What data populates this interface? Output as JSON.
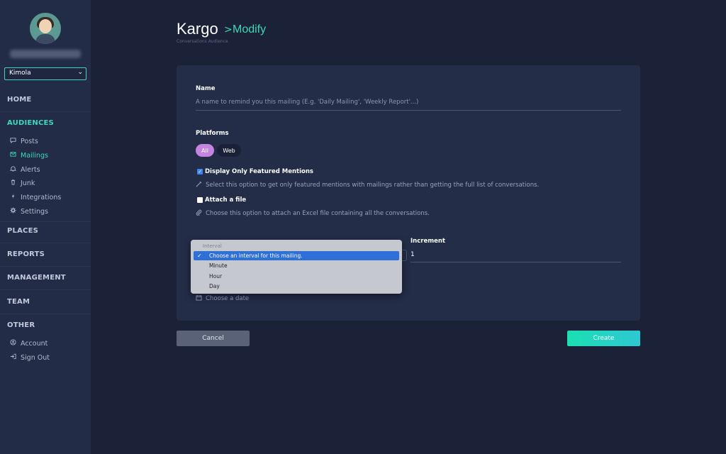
{
  "sidebar": {
    "account": "Kimola",
    "nav": {
      "home": "HOME",
      "audiences": "AUDIENCES",
      "places": "PLACES",
      "reports": "REPORTS",
      "management": "MANAGEMENT",
      "team": "TEAM",
      "other": "OTHER"
    },
    "audience_items": [
      {
        "label": "Posts",
        "icon": "comment-icon"
      },
      {
        "label": "Mailings",
        "icon": "mail-icon"
      },
      {
        "label": "Alerts",
        "icon": "bell-icon"
      },
      {
        "label": "Junk",
        "icon": "trash-icon"
      },
      {
        "label": "Integrations",
        "icon": "bolt-icon"
      },
      {
        "label": "Settings",
        "icon": "gear-icon"
      }
    ],
    "other_items": [
      {
        "label": "Account",
        "icon": "user-circle-icon"
      },
      {
        "label": "Sign Out",
        "icon": "sign-out-icon"
      }
    ]
  },
  "header": {
    "title": "Kargo",
    "separator": ">",
    "section": "Modify",
    "subtitle": "Conversations Audience"
  },
  "form": {
    "name_label": "Name",
    "name_placeholder": "A name to remind you this mailing (E.g. 'Daily Mailing', 'Weekly Report'...)",
    "platforms_label": "Platforms",
    "platforms": [
      "All",
      "Web"
    ],
    "featured_label": "Display Only Featured Mentions",
    "featured_hint": "Select this option to get only featured mentions with mailings rather than getting the full list of conversations.",
    "attach_label": "Attach a file",
    "attach_hint": "Choose this option to attach an Excel file containing all the conversations.",
    "increment_label": "Increment",
    "increment_value": "1",
    "date_placeholder": "Choose a date",
    "interval_dropdown": {
      "group": "Interval",
      "options": [
        "Choose an interval for this mailing.",
        "Minute",
        "Hour",
        "Day"
      ],
      "selected": "Choose an interval for this mailing."
    }
  },
  "buttons": {
    "cancel": "Cancel",
    "create": "Create"
  },
  "colors": {
    "accent": "#3ed8b8",
    "background": "#1b2238",
    "sidebar": "#232c47",
    "card": "#242d48",
    "pill_active": "#c485e0",
    "selection": "#2e6fd8"
  }
}
